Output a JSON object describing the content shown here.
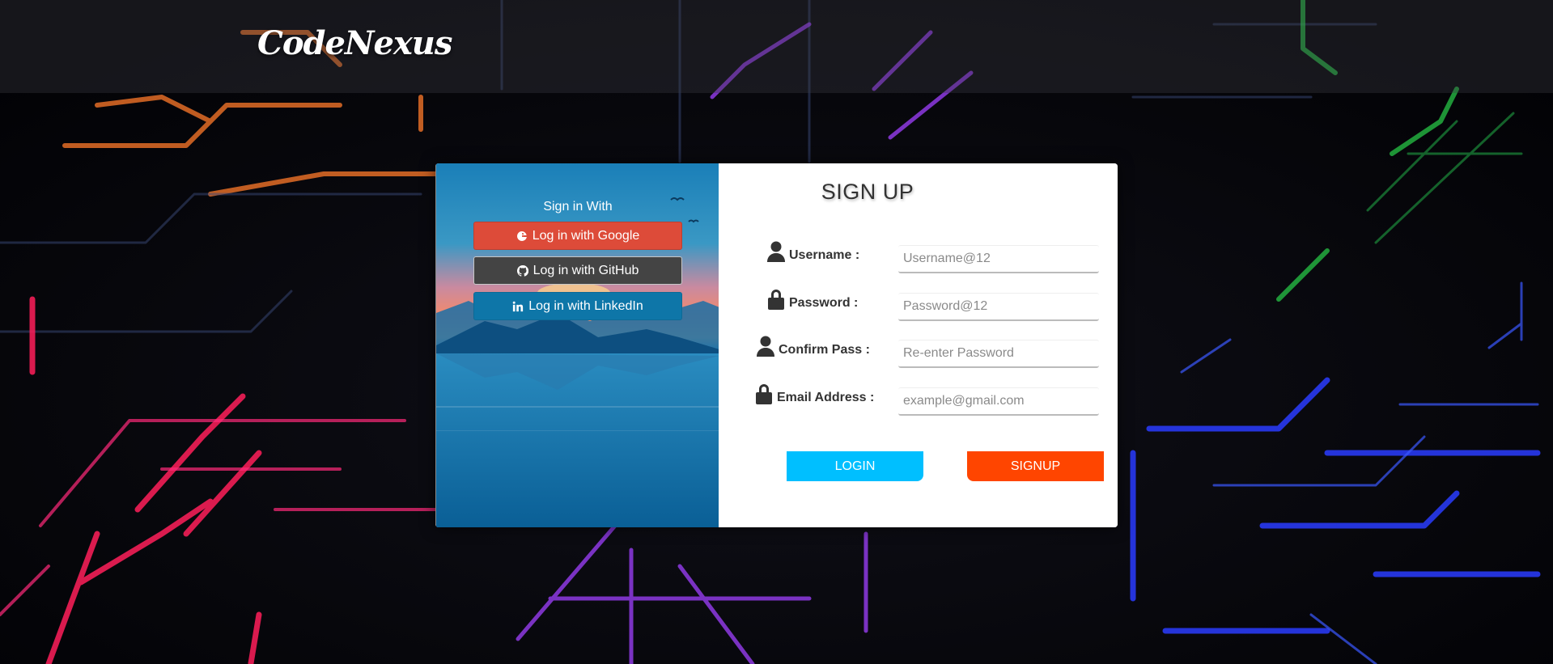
{
  "header": {
    "brand": "CodeNexus"
  },
  "social": {
    "title": "Sign in With",
    "google_label": "Log in with Google",
    "github_label": "Log in with GitHub",
    "linkedin_label": "Log in with LinkedIn"
  },
  "form": {
    "title": "SIGN UP",
    "username": {
      "label": "Username :",
      "placeholder": "Username@12",
      "icon": "user-icon"
    },
    "password": {
      "label": "Password :",
      "placeholder": "Password@12",
      "icon": "lock-icon"
    },
    "confirm": {
      "label": "Confirm Pass :",
      "placeholder": "Re-enter Password",
      "icon": "user-icon"
    },
    "email": {
      "label": "Email Address :",
      "placeholder": "example@gmail.com",
      "icon": "lock-icon"
    },
    "login_label": "LOGIN",
    "signup_label": "SIGNUP"
  },
  "colors": {
    "google": "#dd4b39",
    "github": "#444444",
    "linkedin": "#0e76a8",
    "login": "#00bfff",
    "signup": "#ff4500"
  }
}
